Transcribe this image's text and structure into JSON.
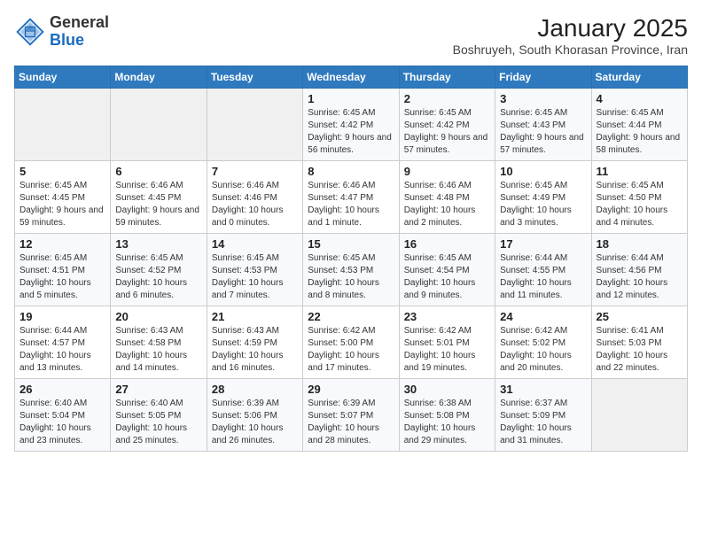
{
  "header": {
    "logo_general": "General",
    "logo_blue": "Blue",
    "title": "January 2025",
    "subtitle": "Boshruyeh, South Khorasan Province, Iran"
  },
  "weekdays": [
    "Sunday",
    "Monday",
    "Tuesday",
    "Wednesday",
    "Thursday",
    "Friday",
    "Saturday"
  ],
  "weeks": [
    [
      {
        "day": "",
        "info": ""
      },
      {
        "day": "",
        "info": ""
      },
      {
        "day": "",
        "info": ""
      },
      {
        "day": "1",
        "info": "Sunrise: 6:45 AM\nSunset: 4:42 PM\nDaylight: 9 hours and 56 minutes."
      },
      {
        "day": "2",
        "info": "Sunrise: 6:45 AM\nSunset: 4:42 PM\nDaylight: 9 hours and 57 minutes."
      },
      {
        "day": "3",
        "info": "Sunrise: 6:45 AM\nSunset: 4:43 PM\nDaylight: 9 hours and 57 minutes."
      },
      {
        "day": "4",
        "info": "Sunrise: 6:45 AM\nSunset: 4:44 PM\nDaylight: 9 hours and 58 minutes."
      }
    ],
    [
      {
        "day": "5",
        "info": "Sunrise: 6:45 AM\nSunset: 4:45 PM\nDaylight: 9 hours and 59 minutes."
      },
      {
        "day": "6",
        "info": "Sunrise: 6:46 AM\nSunset: 4:45 PM\nDaylight: 9 hours and 59 minutes."
      },
      {
        "day": "7",
        "info": "Sunrise: 6:46 AM\nSunset: 4:46 PM\nDaylight: 10 hours and 0 minutes."
      },
      {
        "day": "8",
        "info": "Sunrise: 6:46 AM\nSunset: 4:47 PM\nDaylight: 10 hours and 1 minute."
      },
      {
        "day": "9",
        "info": "Sunrise: 6:46 AM\nSunset: 4:48 PM\nDaylight: 10 hours and 2 minutes."
      },
      {
        "day": "10",
        "info": "Sunrise: 6:45 AM\nSunset: 4:49 PM\nDaylight: 10 hours and 3 minutes."
      },
      {
        "day": "11",
        "info": "Sunrise: 6:45 AM\nSunset: 4:50 PM\nDaylight: 10 hours and 4 minutes."
      }
    ],
    [
      {
        "day": "12",
        "info": "Sunrise: 6:45 AM\nSunset: 4:51 PM\nDaylight: 10 hours and 5 minutes."
      },
      {
        "day": "13",
        "info": "Sunrise: 6:45 AM\nSunset: 4:52 PM\nDaylight: 10 hours and 6 minutes."
      },
      {
        "day": "14",
        "info": "Sunrise: 6:45 AM\nSunset: 4:53 PM\nDaylight: 10 hours and 7 minutes."
      },
      {
        "day": "15",
        "info": "Sunrise: 6:45 AM\nSunset: 4:53 PM\nDaylight: 10 hours and 8 minutes."
      },
      {
        "day": "16",
        "info": "Sunrise: 6:45 AM\nSunset: 4:54 PM\nDaylight: 10 hours and 9 minutes."
      },
      {
        "day": "17",
        "info": "Sunrise: 6:44 AM\nSunset: 4:55 PM\nDaylight: 10 hours and 11 minutes."
      },
      {
        "day": "18",
        "info": "Sunrise: 6:44 AM\nSunset: 4:56 PM\nDaylight: 10 hours and 12 minutes."
      }
    ],
    [
      {
        "day": "19",
        "info": "Sunrise: 6:44 AM\nSunset: 4:57 PM\nDaylight: 10 hours and 13 minutes."
      },
      {
        "day": "20",
        "info": "Sunrise: 6:43 AM\nSunset: 4:58 PM\nDaylight: 10 hours and 14 minutes."
      },
      {
        "day": "21",
        "info": "Sunrise: 6:43 AM\nSunset: 4:59 PM\nDaylight: 10 hours and 16 minutes."
      },
      {
        "day": "22",
        "info": "Sunrise: 6:42 AM\nSunset: 5:00 PM\nDaylight: 10 hours and 17 minutes."
      },
      {
        "day": "23",
        "info": "Sunrise: 6:42 AM\nSunset: 5:01 PM\nDaylight: 10 hours and 19 minutes."
      },
      {
        "day": "24",
        "info": "Sunrise: 6:42 AM\nSunset: 5:02 PM\nDaylight: 10 hours and 20 minutes."
      },
      {
        "day": "25",
        "info": "Sunrise: 6:41 AM\nSunset: 5:03 PM\nDaylight: 10 hours and 22 minutes."
      }
    ],
    [
      {
        "day": "26",
        "info": "Sunrise: 6:40 AM\nSunset: 5:04 PM\nDaylight: 10 hours and 23 minutes."
      },
      {
        "day": "27",
        "info": "Sunrise: 6:40 AM\nSunset: 5:05 PM\nDaylight: 10 hours and 25 minutes."
      },
      {
        "day": "28",
        "info": "Sunrise: 6:39 AM\nSunset: 5:06 PM\nDaylight: 10 hours and 26 minutes."
      },
      {
        "day": "29",
        "info": "Sunrise: 6:39 AM\nSunset: 5:07 PM\nDaylight: 10 hours and 28 minutes."
      },
      {
        "day": "30",
        "info": "Sunrise: 6:38 AM\nSunset: 5:08 PM\nDaylight: 10 hours and 29 minutes."
      },
      {
        "day": "31",
        "info": "Sunrise: 6:37 AM\nSunset: 5:09 PM\nDaylight: 10 hours and 31 minutes."
      },
      {
        "day": "",
        "info": ""
      }
    ]
  ]
}
